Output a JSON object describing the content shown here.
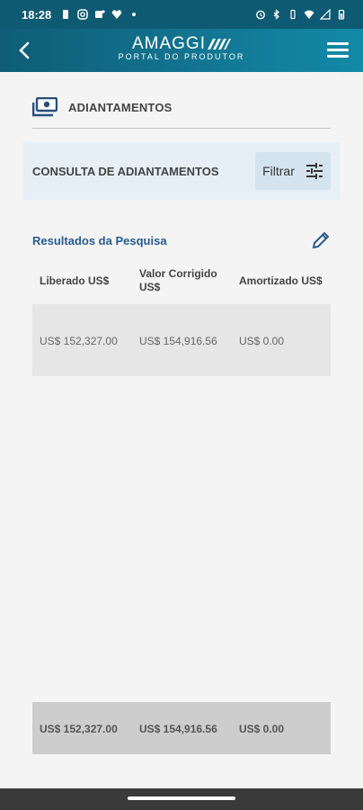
{
  "status_bar": {
    "time": "18:28"
  },
  "app": {
    "logo_main": "AMAGGI",
    "logo_sub": "PORTAL DO PRODUTOR"
  },
  "page": {
    "title": "ADIANTAMENTOS"
  },
  "filter": {
    "heading": "CONSULTA DE ADIANTAMENTOS",
    "button_label": "Filtrar"
  },
  "results": {
    "title": "Resultados da Pesquisa",
    "columns": [
      "Liberado US$",
      "Valor Corrigido US$",
      "Amortizado US$"
    ],
    "rows": [
      [
        "US$ 152,327.00",
        "US$ 154,916.56",
        "US$ 0.00"
      ]
    ],
    "totals": [
      "US$ 152,327.00",
      "US$ 154,916.56",
      "US$ 0.00"
    ]
  },
  "colors": {
    "header": "#127591",
    "accent_text": "#275a8c",
    "filter_panel": "#e5eff5"
  },
  "icons": [
    "back-arrow-icon",
    "amaggi-logo-icon",
    "menu-icon",
    "money-icon",
    "filter-sliders-icon",
    "edit-pencil-icon"
  ]
}
